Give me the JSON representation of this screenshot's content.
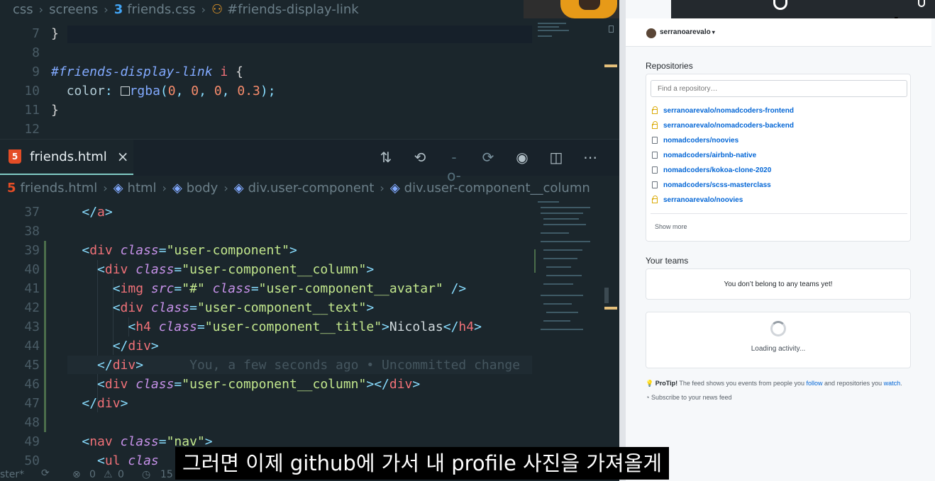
{
  "editor": {
    "top_breadcrumb": [
      "css",
      "screens",
      "friends.css",
      "#friends-display-link"
    ],
    "css_lines": [
      {
        "n": "7",
        "html": "<span class=\"t-brace\">}</span>"
      },
      {
        "n": "8",
        "html": ""
      },
      {
        "n": "9",
        "html": "<span class=\"t-sel\">#friends-display-link</span> <span class=\"t-tag\">i</span> <span class=\"t-brace\">{</span>"
      },
      {
        "n": "10",
        "html": "  <span class=\"t-prop\">color</span><span class=\"t-punc\">:</span> <span style=\"display:inline-block;width:13px;height:13px;border:1px solid #cfd8dc;vertical-align:-1px;\"></span><span class=\"t-fn\">rgba</span><span class=\"t-punc\">(</span><span class=\"t-num\">0</span><span class=\"t-punc\">,</span> <span class=\"t-num\">0</span><span class=\"t-punc\">,</span> <span class=\"t-num\">0</span><span class=\"t-punc\">,</span> <span class=\"t-num\">0.3</span><span class=\"t-punc\">);</span>"
      },
      {
        "n": "11",
        "html": "<span class=\"t-brace\">}</span>"
      },
      {
        "n": "12",
        "html": ""
      }
    ],
    "tab": {
      "label": "friends.html",
      "close": "×"
    },
    "html_breadcrumb": [
      "friends.html",
      "html",
      "body",
      "div.user-component",
      "div.user-component__column"
    ],
    "html_lines": [
      {
        "n": "37",
        "html": "    <span class=\"t-punc\">&lt;/</span><span class=\"t-tag\">a</span><span class=\"t-punc\">&gt;</span>"
      },
      {
        "n": "38",
        "html": ""
      },
      {
        "n": "39",
        "html": "    <span class=\"t-punc\">&lt;</span><span class=\"t-tag\">div</span> <span class=\"t-attr\">class</span><span class=\"t-punc\">=</span><span class=\"t-str\">\"user-component\"</span><span class=\"t-punc\">&gt;</span>"
      },
      {
        "n": "40",
        "html": "      <span class=\"t-punc\">&lt;</span><span class=\"t-tag\">div</span> <span class=\"t-attr\">class</span><span class=\"t-punc\">=</span><span class=\"t-str\">\"user-component__column\"</span><span class=\"t-punc\">&gt;</span>"
      },
      {
        "n": "41",
        "html": "        <span class=\"t-punc\">&lt;</span><span class=\"t-tag\">img</span> <span class=\"t-attr\">src</span><span class=\"t-punc\">=</span><span class=\"t-str\">\"#\"</span> <span class=\"t-attr\">class</span><span class=\"t-punc\">=</span><span class=\"t-str\">\"user-component__avatar\"</span> <span class=\"t-punc\">/&gt;</span>"
      },
      {
        "n": "42",
        "html": "        <span class=\"t-punc\">&lt;</span><span class=\"t-tag\">div</span> <span class=\"t-attr\">class</span><span class=\"t-punc\">=</span><span class=\"t-str\">\"user-component__text\"</span><span class=\"t-punc\">&gt;</span>"
      },
      {
        "n": "43",
        "html": "          <span class=\"t-punc\">&lt;</span><span class=\"t-tag\">h4</span> <span class=\"t-attr\">class</span><span class=\"t-punc\">=</span><span class=\"t-str\">\"user-component__title\"</span><span class=\"t-punc\">&gt;</span>Nicolas<span class=\"t-punc\">&lt;/</span><span class=\"t-tag\">h4</span><span class=\"t-punc\">&gt;</span>"
      },
      {
        "n": "44",
        "html": "        <span class=\"t-punc\">&lt;/</span><span class=\"t-tag\">div</span><span class=\"t-punc\">&gt;</span>"
      },
      {
        "n": "45",
        "html": "      <span class=\"t-punc\">&lt;/</span><span class=\"t-tag\">div</span><span class=\"t-punc\">&gt;</span>      <span class=\"t-ghost\">You, a few seconds ago • Uncommitted change</span>"
      },
      {
        "n": "46",
        "html": "      <span class=\"t-punc\">&lt;</span><span class=\"t-tag\">div</span> <span class=\"t-attr\">class</span><span class=\"t-punc\">=</span><span class=\"t-str\">\"user-component__column\"</span><span class=\"t-punc\">&gt;&lt;/</span><span class=\"t-tag\">div</span><span class=\"t-punc\">&gt;</span>"
      },
      {
        "n": "47",
        "html": "    <span class=\"t-punc\">&lt;/</span><span class=\"t-tag\">div</span><span class=\"t-punc\">&gt;</span>"
      },
      {
        "n": "48",
        "html": ""
      },
      {
        "n": "49",
        "html": "    <span class=\"t-punc\">&lt;</span><span class=\"t-tag\">nav</span> <span class=\"t-attr\">class</span><span class=\"t-punc\">=</span><span class=\"t-str\">\"nav\"</span><span class=\"t-punc\">&gt;</span>"
      },
      {
        "n": "50",
        "html": "      <span class=\"t-punc\">&lt;</span><span class=\"t-tag\">ul</span> <span class=\"t-attr\">clas</span>"
      }
    ],
    "status": {
      "branch": "ster*",
      "errors": "0",
      "warnings": "0",
      "extra": "15"
    }
  },
  "github": {
    "username": "serranoarevalo",
    "repositories_heading": "Repositories",
    "find_placeholder": "Find a repository…",
    "repos": [
      {
        "name": "serranoarevalo/nomadcoders-frontend",
        "icon": "lock-icon"
      },
      {
        "name": "serranoarevalo/nomadcoders-backend",
        "icon": "lock-icon"
      },
      {
        "name": "nomadcoders/noovies",
        "icon": "repo-icon"
      },
      {
        "name": "nomadcoders/airbnb-native",
        "icon": "repo-icon"
      },
      {
        "name": "nomadcoders/kokoa-clone-2020",
        "icon": "repo-icon"
      },
      {
        "name": "nomadcoders/scss-masterclass",
        "icon": "repo-icon"
      },
      {
        "name": "serranoarevalo/noovies",
        "icon": "lock-icon"
      }
    ],
    "show_more": "Show more",
    "teams_heading": "Your teams",
    "teams_message": "You don’t belong to any teams yet!",
    "loading": "Loading activity...",
    "protip_label": "ProTip!",
    "protip_text_1": " The feed shows you events from people you ",
    "protip_follow": "follow",
    "protip_text_2": " and repositories you ",
    "protip_watch": "watch",
    "protip_end": ".",
    "subscribe": "Subscribe to your news feed"
  },
  "subtitle": "그러면 이제 github에 가서 내 profile 사진을 가져올게",
  "colors": {
    "editor_bg": "#1b262c",
    "accent": "#80cbc4",
    "link": "#0366d6"
  }
}
